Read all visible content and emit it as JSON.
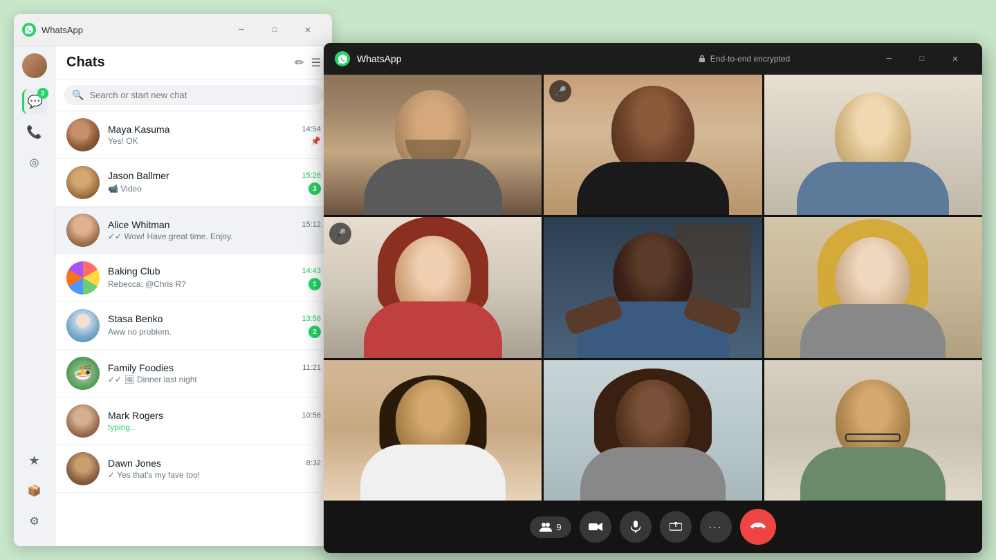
{
  "mainWindow": {
    "title": "WhatsApp",
    "titlebar": {
      "title": "WhatsApp",
      "minimize": "─",
      "maximize": "□",
      "close": "✕"
    }
  },
  "sidebar": {
    "badge": "3",
    "icons": {
      "menu": "☰",
      "chats": "💬",
      "calls": "📞",
      "status": "◎",
      "favorites": "★",
      "archived": "📦",
      "settings": "⚙"
    }
  },
  "chats": {
    "title": "Chats",
    "newChat": "✏",
    "filter": "☰",
    "search": {
      "placeholder": "Search or start new chat"
    },
    "items": [
      {
        "name": "Maya Kasuma",
        "preview": "Yes! OK",
        "time": "14:54",
        "timeGreen": false,
        "unread": 0,
        "pinned": true,
        "avatarColor": "av-1",
        "avatarInitial": "M"
      },
      {
        "name": "Jason Ballmer",
        "preview": "📹 Video",
        "time": "15:26",
        "timeGreen": true,
        "unread": 3,
        "pinned": false,
        "avatarColor": "av-2",
        "avatarInitial": "J"
      },
      {
        "name": "Alice Whitman",
        "preview": "✓✓ Wow! Have great time. Enjoy.",
        "time": "15:12",
        "timeGreen": false,
        "unread": 0,
        "pinned": false,
        "active": true,
        "avatarColor": "av-3",
        "avatarInitial": "A"
      },
      {
        "name": "Baking Club",
        "preview": "Rebecca: @Chris R?",
        "time": "14:43",
        "timeGreen": true,
        "unread": 1,
        "mention": true,
        "pinned": false,
        "avatarColor": "av-4",
        "avatarInitial": "B"
      },
      {
        "name": "Stasa Benko",
        "preview": "Aww no problem.",
        "time": "13:56",
        "timeGreen": true,
        "unread": 2,
        "pinned": false,
        "avatarColor": "av-5",
        "avatarInitial": "S"
      },
      {
        "name": "Family Foodies",
        "preview": "✓✓ 🖼 Dinner last night",
        "time": "11:21",
        "timeGreen": false,
        "unread": 0,
        "pinned": false,
        "avatarColor": "av-6",
        "avatarInitial": "F"
      },
      {
        "name": "Mark Rogers",
        "preview": "typing...",
        "time": "10:56",
        "timeGreen": false,
        "unread": 0,
        "pinned": false,
        "typing": true,
        "avatarColor": "av-7",
        "avatarInitial": "M"
      },
      {
        "name": "Dawn Jones",
        "preview": "✓ Yes that's my fave too!",
        "time": "8:32",
        "timeGreen": false,
        "unread": 0,
        "pinned": false,
        "avatarColor": "av-8",
        "avatarInitial": "D"
      }
    ]
  },
  "callWindow": {
    "title": "WhatsApp",
    "encryption": "End-to-end encrypted",
    "participants": "9",
    "controls": {
      "participants_label": "9",
      "video": "📹",
      "mic": "🎤",
      "share": "↑",
      "more": "•••",
      "end": "📵"
    }
  },
  "videoGrid": {
    "cells": [
      {
        "id": 1,
        "micOff": false,
        "highlighted": false
      },
      {
        "id": 2,
        "micOff": true,
        "highlighted": false
      },
      {
        "id": 3,
        "micOff": false,
        "highlighted": false
      },
      {
        "id": 4,
        "micOff": true,
        "highlighted": false
      },
      {
        "id": 5,
        "micOff": false,
        "highlighted": true
      },
      {
        "id": 6,
        "micOff": false,
        "highlighted": false
      },
      {
        "id": 7,
        "micOff": false,
        "highlighted": false
      },
      {
        "id": 8,
        "micOff": false,
        "highlighted": false
      },
      {
        "id": 9,
        "micOff": false,
        "highlighted": false
      }
    ]
  }
}
